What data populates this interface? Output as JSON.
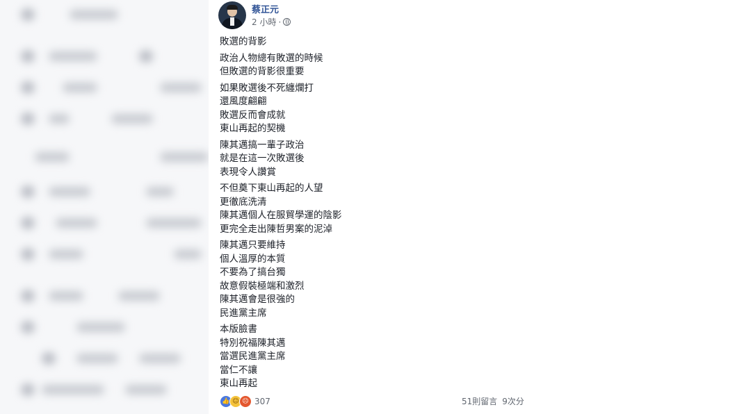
{
  "author": {
    "name": "蔡正元"
  },
  "meta": {
    "time": "2 小時",
    "separator": "·",
    "privacy_icon": "globe-icon"
  },
  "post": {
    "stanzas": [
      [
        "敗選的背影"
      ],
      [
        "政治人物總有敗選的時候",
        "但敗選的背影很重要"
      ],
      [
        "如果敗選後不死纏爛打",
        "還風度翩翩",
        "敗選反而會成就",
        "東山再起的契機"
      ],
      [
        "陳其邁搞一輩子政治",
        "就是在這一次敗選後",
        "表現令人讚賞"
      ],
      [
        "不但奠下東山再起的人望",
        "更徹底洗清",
        "陳其邁個人在服貿學運的陰影",
        "更完全走出陳哲男案的泥淖"
      ],
      [
        "陳其邁只要維持",
        "個人溫厚的本質",
        "不要為了搞台獨",
        "故意假裝極端和激烈",
        "陳其邁會是很強的",
        "民進黨主席"
      ],
      [
        "本版臉書",
        "特別祝福陳其邁",
        "當選民進黨主席",
        "當仁不讓",
        "東山再起"
      ]
    ]
  },
  "footer": {
    "reaction_count": "307",
    "reaction_icons": [
      "like-icon",
      "haha-icon",
      "angry-icon"
    ],
    "comments": "51則留言",
    "shares": "9次分"
  },
  "colors": {
    "author": "#365899",
    "meta": "#616770",
    "text": "#1d2129"
  }
}
